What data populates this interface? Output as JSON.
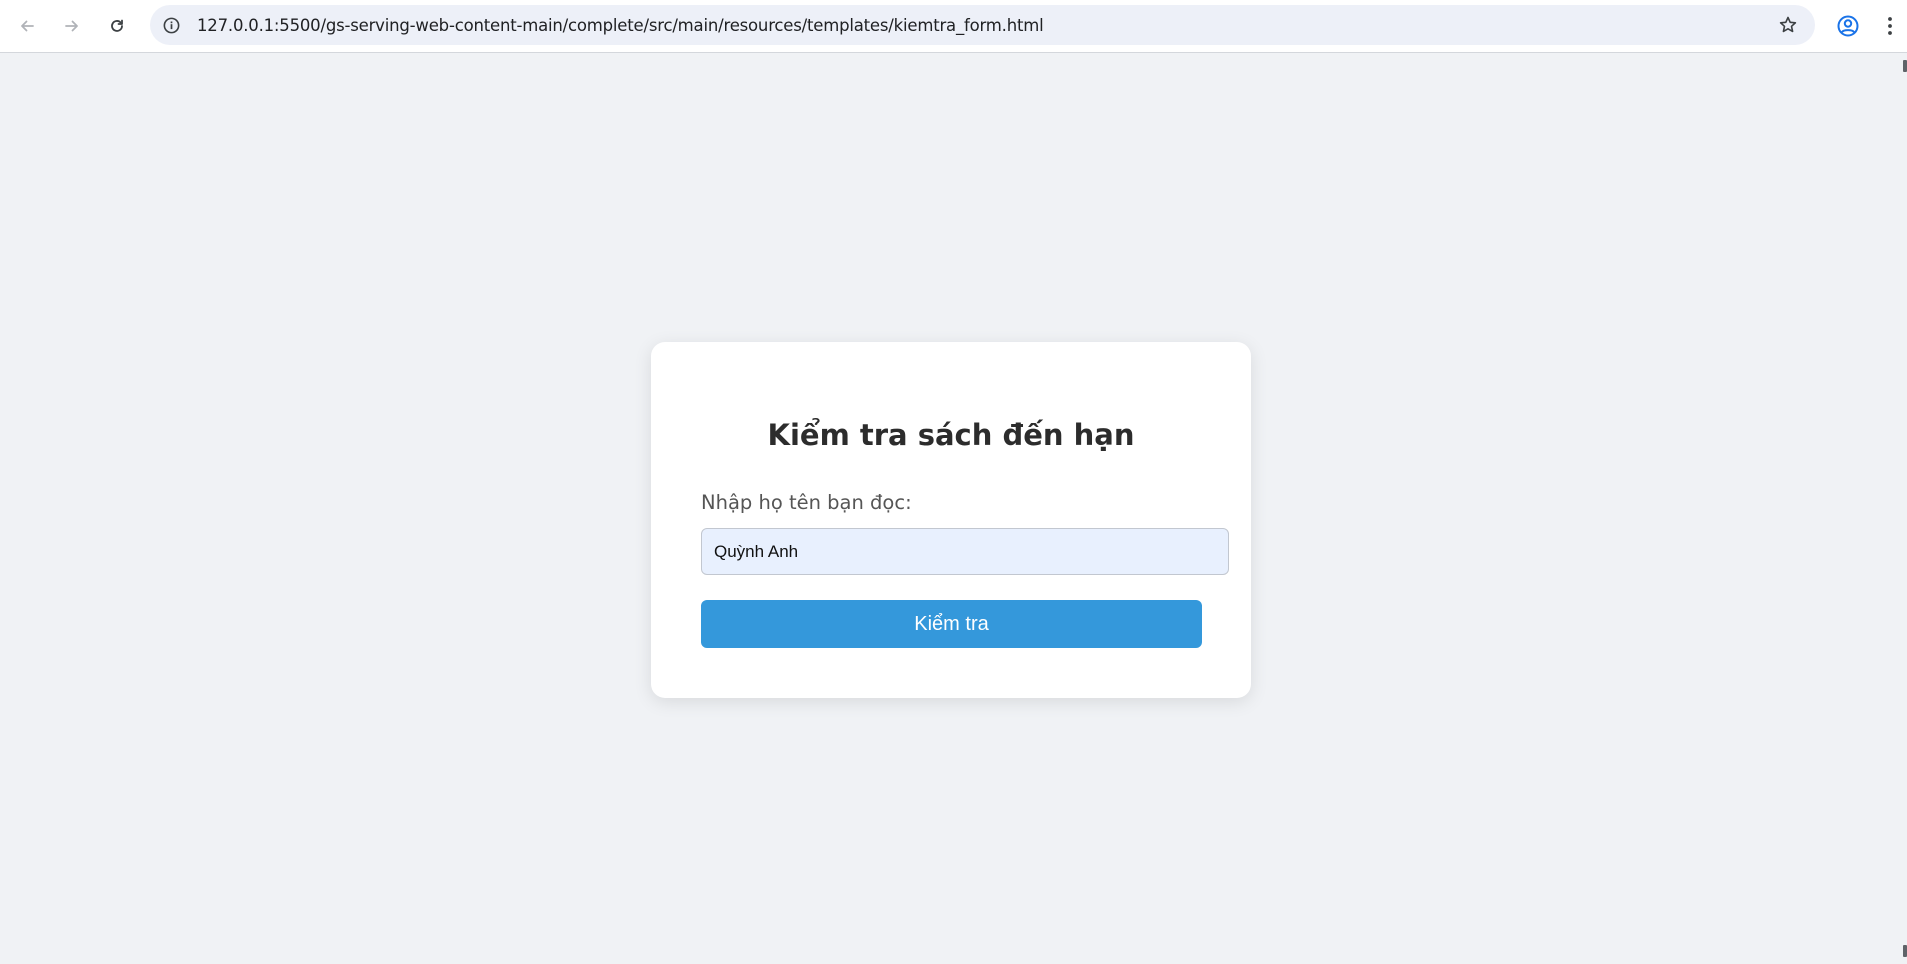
{
  "browser": {
    "url": "127.0.0.1:5500/gs-serving-web-content-main/complete/src/main/resources/templates/kiemtra_form.html",
    "icons": {
      "back": "arrow-left-icon",
      "forward": "arrow-right-icon",
      "reload": "reload-icon",
      "site_info": "info-icon",
      "bookmark": "star-icon",
      "profile": "profile-icon",
      "menu": "kebab-menu-icon"
    },
    "accent_color": "#1a73e8"
  },
  "form": {
    "title": "Kiểm tra sách đến hạn",
    "label": "Nhập họ tên bạn đọc:",
    "input_value": "Quỳnh Anh",
    "button_label": "Kiểm tra",
    "button_color": "#3498db",
    "input_background": "#e8f0fe"
  }
}
